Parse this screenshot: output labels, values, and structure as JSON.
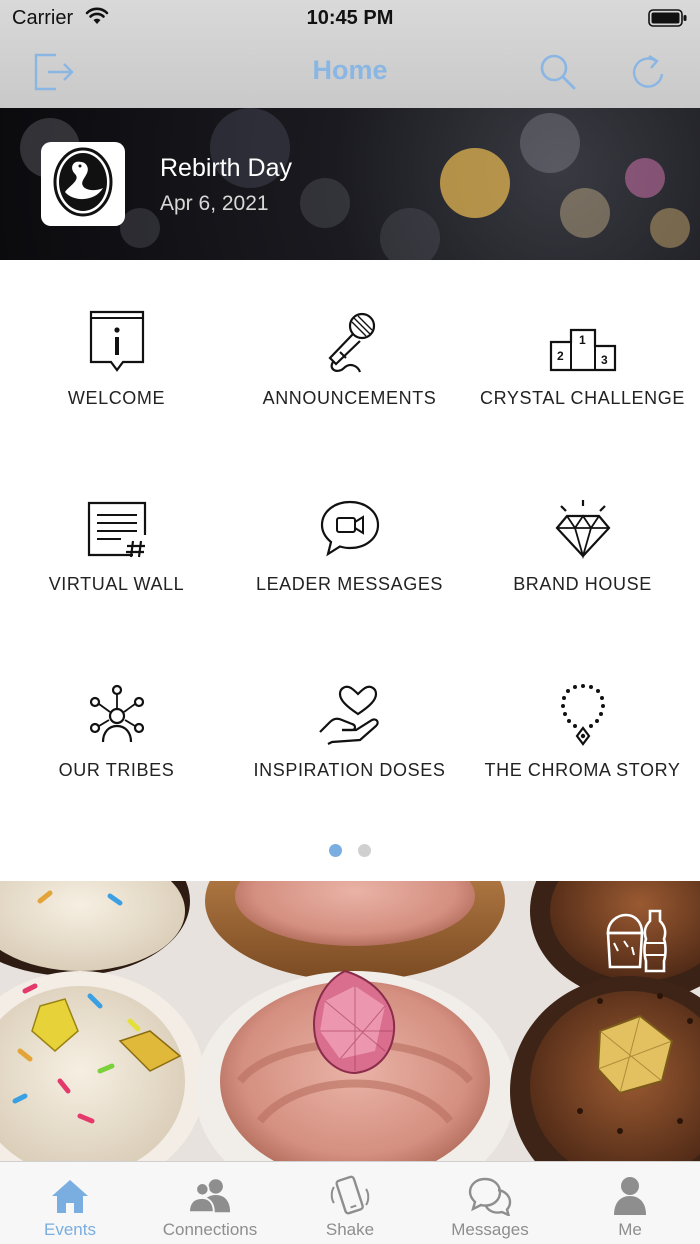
{
  "status_bar": {
    "carrier": "Carrier",
    "time": "10:45 PM"
  },
  "nav": {
    "title": "Home",
    "accent": "#8ab6e3",
    "left_icon": "logout-icon",
    "right_icons": [
      "search-icon",
      "refresh-icon"
    ]
  },
  "event": {
    "title": "Rebirth Day",
    "date": "Apr 6, 2021",
    "logo_icon": "swan-logo-icon"
  },
  "grid": {
    "items": [
      {
        "label": "WELCOME",
        "icon": "info-icon"
      },
      {
        "label": "ANNOUNCEMENTS",
        "icon": "microphone-icon"
      },
      {
        "label": "CRYSTAL CHALLENGE",
        "icon": "podium-icon"
      },
      {
        "label": "VIRTUAL WALL",
        "icon": "wall-post-icon"
      },
      {
        "label": "LEADER MESSAGES",
        "icon": "video-chat-icon"
      },
      {
        "label": "BRAND HOUSE",
        "icon": "diamond-icon"
      },
      {
        "label": "OUR TRIBES",
        "icon": "community-icon"
      },
      {
        "label": "INSPIRATION DOSES",
        "icon": "heart-hand-icon"
      },
      {
        "label": "THE CHROMA STORY",
        "icon": "necklace-icon"
      }
    ],
    "page_indicator": {
      "pages": 2,
      "current": 1,
      "active_color": "#7aaee0",
      "inactive_color": "#d0d0d0"
    }
  },
  "promo": {
    "image": "cupcakes-with-crystals",
    "badge_icon": "food-drink-icon"
  },
  "tabbar": {
    "active_color": "#7aaee0",
    "inactive_color": "#8e8e8e",
    "items": [
      {
        "label": "Events",
        "icon": "home-icon",
        "active": true
      },
      {
        "label": "Connections",
        "icon": "people-icon",
        "active": false
      },
      {
        "label": "Shake",
        "icon": "shake-phone-icon",
        "active": false
      },
      {
        "label": "Messages",
        "icon": "chat-bubbles-icon",
        "active": false
      },
      {
        "label": "Me",
        "icon": "person-icon",
        "active": false
      }
    ]
  }
}
